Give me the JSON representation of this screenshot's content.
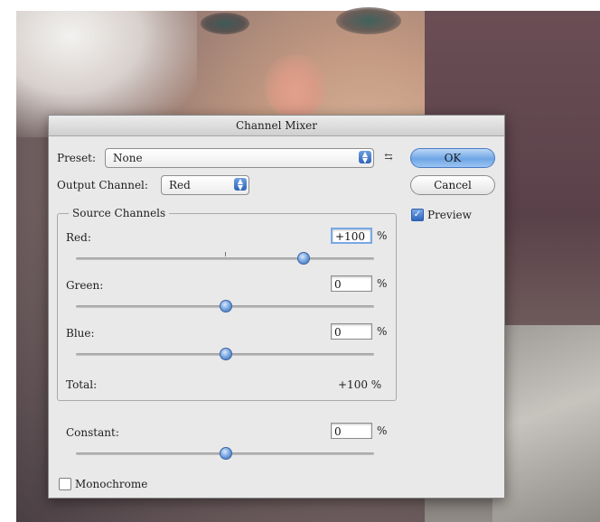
{
  "dialog": {
    "title": "Channel Mixer",
    "preset": {
      "label": "Preset:",
      "value": "None"
    },
    "output_channel": {
      "label": "Output Channel:",
      "value": "Red"
    },
    "buttons": {
      "ok": "OK",
      "cancel": "Cancel"
    },
    "preview": {
      "label": "Preview",
      "checked": true
    },
    "source_channels": {
      "title": "Source Channels",
      "red": {
        "label": "Red:",
        "value": "+100",
        "unit": "%",
        "slider_fraction": 0.75
      },
      "green": {
        "label": "Green:",
        "value": "0",
        "unit": "%",
        "slider_fraction": 0.5
      },
      "blue": {
        "label": "Blue:",
        "value": "0",
        "unit": "%",
        "slider_fraction": 0.5
      },
      "total": {
        "label": "Total:",
        "value": "+100 %"
      }
    },
    "constant": {
      "label": "Constant:",
      "value": "0",
      "unit": "%",
      "slider_fraction": 0.5
    },
    "monochrome": {
      "label": "Monochrome",
      "checked": false
    }
  },
  "icons": {
    "preset_menu": "preset-options-icon",
    "select_arrows": "updown-arrows-icon",
    "check": "checkmark-icon"
  }
}
